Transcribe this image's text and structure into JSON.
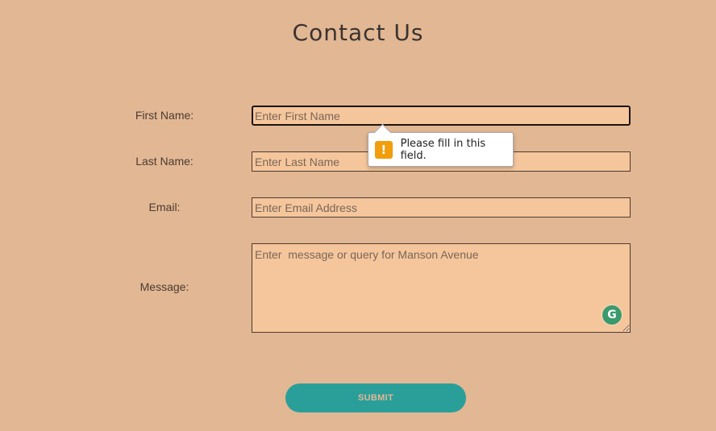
{
  "page": {
    "title": "Contact Us"
  },
  "form": {
    "first_name": {
      "label": "First Name:",
      "placeholder": "Enter First Name",
      "value": ""
    },
    "last_name": {
      "label": "Last Name:",
      "placeholder": "Enter Last Name",
      "value": ""
    },
    "email": {
      "label": "Email:",
      "placeholder": "Enter Email Address",
      "value": ""
    },
    "message": {
      "label": "Message:",
      "placeholder": "Enter  message or query for Manson Avenue",
      "value": ""
    },
    "submit_label": "SUBMIT"
  },
  "validation_tooltip": {
    "icon": "warning-icon",
    "icon_glyph": "!",
    "text": "Please fill in this field."
  },
  "grammarly": {
    "icon": "grammarly-icon",
    "glyph": "G"
  },
  "colors": {
    "background": "#e2b793",
    "field_background": "#f5c69c",
    "button": "#2a9f9a",
    "warning": "#f29d0b",
    "grammarly": "#3b9a6d"
  }
}
